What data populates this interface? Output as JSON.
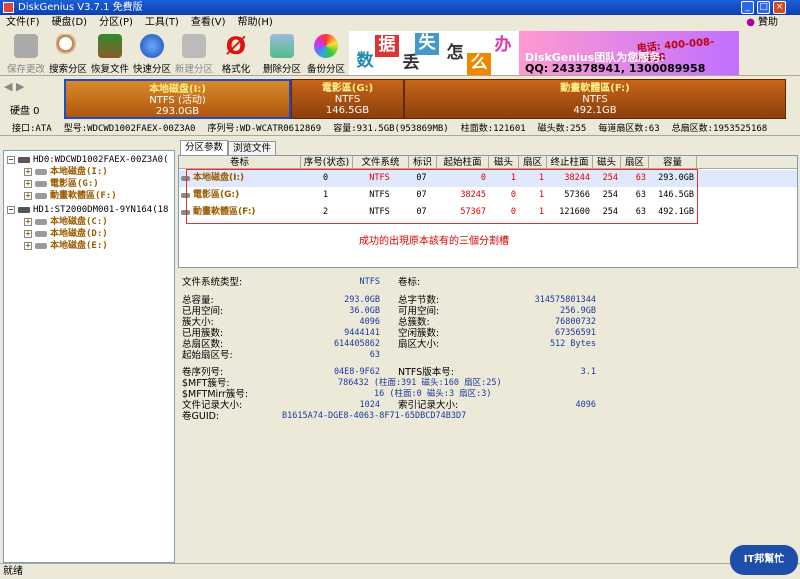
{
  "window": {
    "title": "DiskGenius V3.7.1 免費版",
    "min": "_",
    "max": "□",
    "close": "×"
  },
  "menu": {
    "items": [
      "文件(F)",
      "硬盘(D)",
      "分区(P)",
      "工具(T)",
      "查看(V)",
      "帮助(H)"
    ],
    "donate": "贊助"
  },
  "toolbar": {
    "buttons": [
      {
        "label": "保存更改",
        "enabled": false,
        "icon": "save-icon"
      },
      {
        "label": "搜索分区",
        "enabled": true,
        "icon": "magnifier-icon"
      },
      {
        "label": "恢复文件",
        "enabled": true,
        "icon": "restore-icon"
      },
      {
        "label": "快速分区",
        "enabled": true,
        "icon": "globe-icon"
      },
      {
        "label": "新建分区",
        "enabled": false,
        "icon": "computer-icon"
      },
      {
        "label": "格式化",
        "enabled": true,
        "icon": "omega-icon"
      },
      {
        "label": "删除分区",
        "enabled": true,
        "icon": "trash-icon"
      },
      {
        "label": "备份分区",
        "enabled": true,
        "icon": "disc-icon"
      }
    ]
  },
  "banner": {
    "chars": [
      "数",
      "据",
      "丢",
      "失",
      "怎",
      "么",
      "办"
    ],
    "brand": "DiskGenius团队为您服务:",
    "phone": "电话: 400-008-9958",
    "qq": "QQ: 243378941, 1300089958"
  },
  "diskmap": {
    "disk_label": "硬盘 0",
    "partitions": [
      {
        "name": "本地磁盘(I:)",
        "fs": "NTFS (活动)",
        "size": "293.0GB"
      },
      {
        "name": "電影區(G:)",
        "fs": "NTFS",
        "size": "146.5GB"
      },
      {
        "name": "動畫軟體區(F:)",
        "fs": "NTFS",
        "size": "492.1GB"
      }
    ]
  },
  "infoline": [
    "接口:ATA",
    "型号:WDCWD1002FAEX-00Z3A0",
    "序列号:WD-WCATR0612869",
    "容量:931.5GB(953869MB)",
    "柱面数:121601",
    "磁头数:255",
    "每道扇区数:63",
    "总扇区数:1953525168"
  ],
  "tree": [
    {
      "text": "HD0:WDCWD1002FAEX-00Z3A0(",
      "type": "disk",
      "level": 0
    },
    {
      "text": "本地磁盘(I:)",
      "type": "part",
      "level": 1
    },
    {
      "text": "電影區(G:)",
      "type": "part",
      "level": 1
    },
    {
      "text": "動畫軟體區(F:)",
      "type": "part",
      "level": 1
    },
    {
      "text": "HD1:ST2000DM001-9YN164(18",
      "type": "disk",
      "level": 0
    },
    {
      "text": "本地磁盘(C:)",
      "type": "part",
      "level": 1
    },
    {
      "text": "本地磁盘(D:)",
      "type": "part",
      "level": 1
    },
    {
      "text": "本地磁盘(E:)",
      "type": "part",
      "level": 1
    }
  ],
  "tabs": [
    "分区参数",
    "浏览文件"
  ],
  "table": {
    "headers": [
      "卷标",
      "序号(状态)",
      "文件系统",
      "标识",
      "起始柱面",
      "磁头",
      "扇区",
      "终止柱面",
      "磁头",
      "扇区",
      "容量"
    ],
    "rows": [
      [
        "本地磁盘(I:)",
        "0",
        "NTFS",
        "07",
        "0",
        "1",
        "1",
        "38244",
        "254",
        "63",
        "293.0GB"
      ],
      [
        "電影區(G:)",
        "1",
        "NTFS",
        "07",
        "38245",
        "0",
        "1",
        "57366",
        "254",
        "63",
        "146.5GB"
      ],
      [
        "動畫軟體區(F:)",
        "2",
        "NTFS",
        "07",
        "57367",
        "0",
        "1",
        "121600",
        "254",
        "63",
        "492.1GB"
      ]
    ],
    "note": "成功的出現原本該有的三個分割槽"
  },
  "details": {
    "fs_type_label": "文件系统类型:",
    "fs_type": "NTFS",
    "vol_label_label": "卷标:",
    "left": [
      [
        "总容量:",
        "293.0GB"
      ],
      [
        "已用空间:",
        "36.0GB"
      ],
      [
        "簇大小:",
        "4096"
      ],
      [
        "已用簇数:",
        "9444141"
      ],
      [
        "总扇区数:",
        "614405862"
      ],
      [
        "起始扇区号:",
        "63"
      ]
    ],
    "right": [
      [
        "总字节数:",
        "314575801344"
      ],
      [
        "可用空间:",
        "256.9GB"
      ],
      [
        "总簇数:",
        "76800732"
      ],
      [
        "空闲簇数:",
        "67356591"
      ],
      [
        "扇区大小:",
        "512 Bytes"
      ]
    ],
    "serial_label": "卷序列号:",
    "serial": "04E8-9F62",
    "ntfs_ver_label": "NTFS版本号:",
    "ntfs_ver": "3.1",
    "mft_label": "$MFT簇号:",
    "mft": "786432 (柱面:391 磁头:160 扇区:25)",
    "mftmirr_label": "$MFTMirr簇号:",
    "mftmirr": "16 (柱面:0 磁头:3 扇区:3)",
    "frs_label": "文件记录大小:",
    "frs": "1024",
    "idx_label": "索引记录大小:",
    "idx": "4096",
    "guid_label": "卷GUID:",
    "guid": "B1615A74-DGE8-4063-8F71-65DBCD74B3D7"
  },
  "status": "就绪",
  "watermark": "IT邦幫忙",
  "colors": {
    "title": "#1c5fd6",
    "partition": "#c8651a",
    "selected": "#1d4ec0",
    "note": "#d00000"
  }
}
